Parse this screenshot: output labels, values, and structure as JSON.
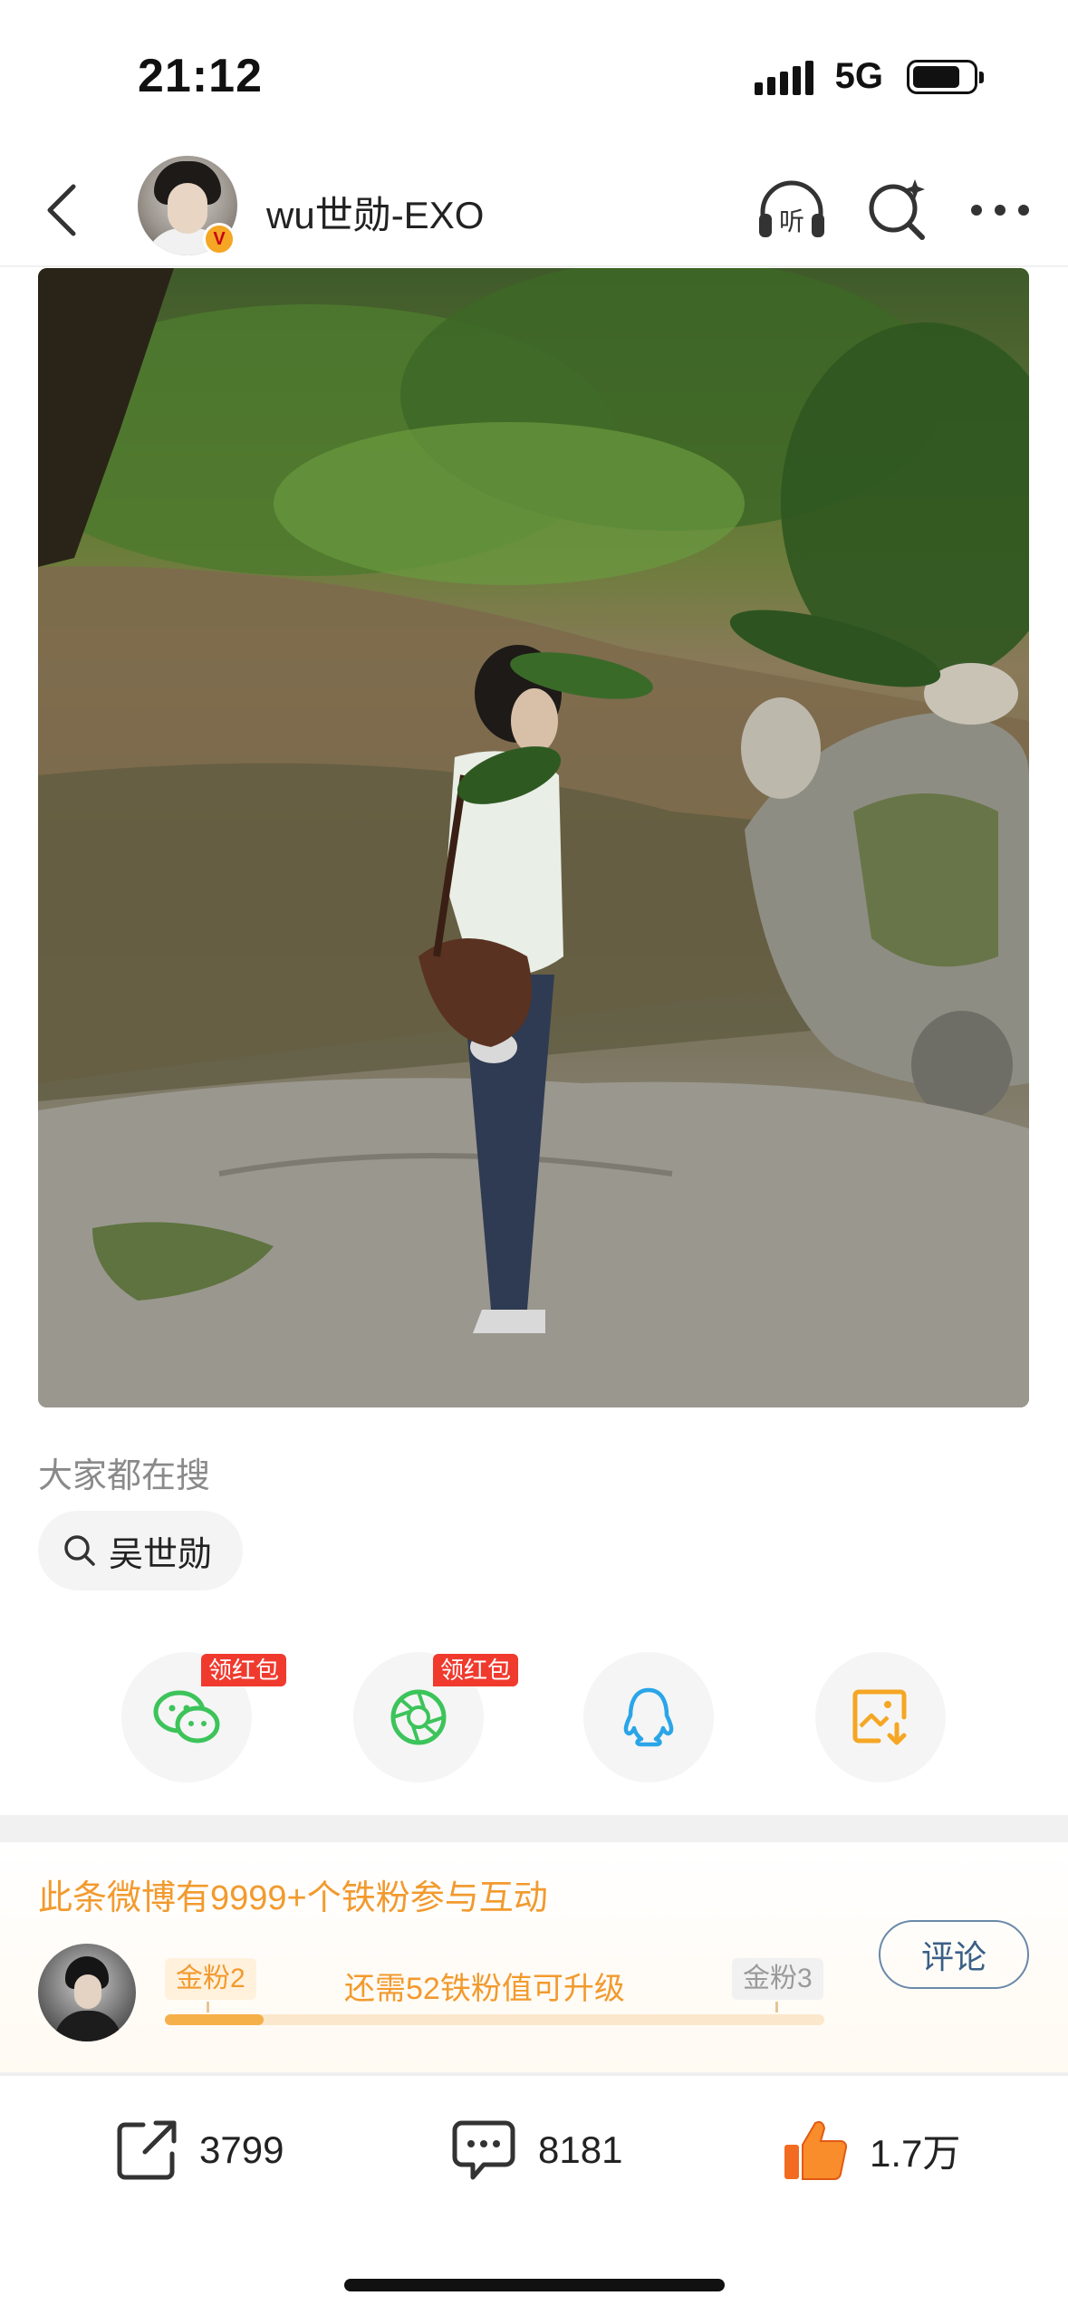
{
  "status_bar": {
    "time": "21:12",
    "network": "5G"
  },
  "header": {
    "username": "wu世勋-EXO",
    "verified_badge": "V"
  },
  "search": {
    "title": "大家都在搜",
    "chip_label": "吴世勋"
  },
  "share": {
    "hongbao_label_1": "领红包",
    "hongbao_label_2": "领红包"
  },
  "fans": {
    "title": "此条微博有9999+个铁粉参与互动",
    "current_level": "金粉2",
    "next_level": "金粉3",
    "upgrade_text": "还需52铁粉值可升级",
    "progress": 0.15,
    "comment_label": "评论"
  },
  "actions": {
    "repost_count": "3799",
    "comment_count": "8181",
    "like_count": "1.7万"
  },
  "colors": {
    "accent_orange": "#f29a2e",
    "hongbao_red": "#f03a2e",
    "wechat_green": "#3cc45a",
    "qq_blue": "#2aa5e8",
    "save_orange": "#f5a623"
  }
}
